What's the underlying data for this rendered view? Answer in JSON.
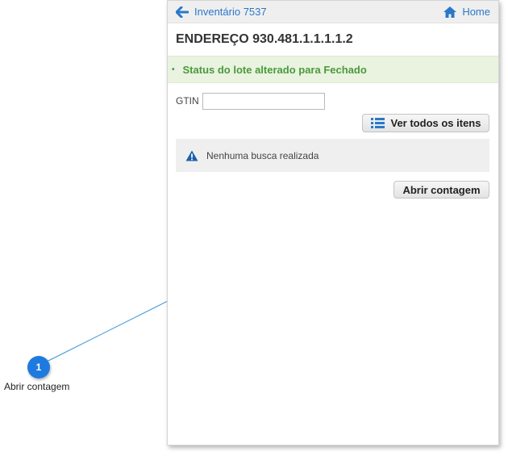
{
  "nav": {
    "back_label": "Inventário 7537",
    "home_label": "Home"
  },
  "page": {
    "title": "ENDEREÇO 930.481.1.1.1.1.2"
  },
  "alert": {
    "message": "Status do lote alterado para Fechado"
  },
  "form": {
    "gtin_label": "GTIN",
    "gtin_value": ""
  },
  "buttons": {
    "view_all_items": "Ver todos os itens",
    "open_count": "Abrir contagem"
  },
  "info": {
    "message": "Nenhuma busca realizada"
  },
  "callout": {
    "number": "1",
    "label": "Abrir contagem"
  },
  "colors": {
    "accent": "#2a78c9",
    "alert_bg": "#e9f3e0",
    "alert_text": "#4a9a3a",
    "callout": "#1f7ae0"
  }
}
